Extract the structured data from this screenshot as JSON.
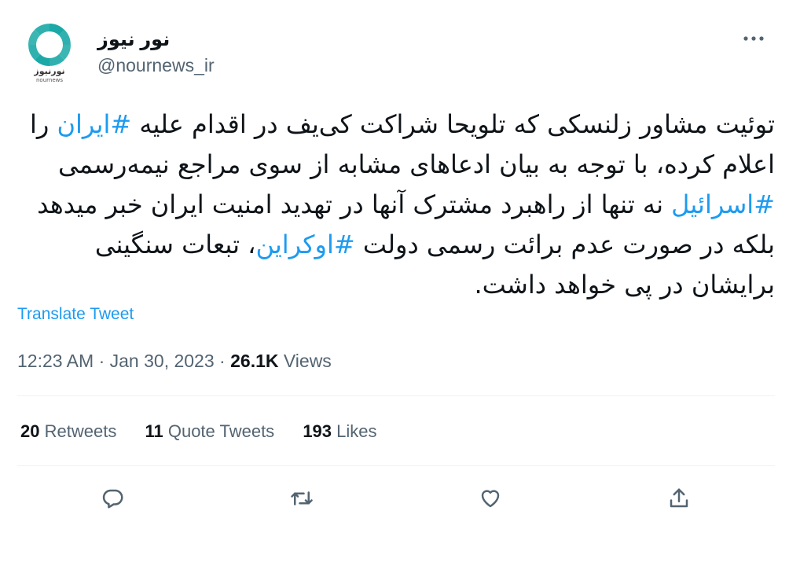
{
  "author": {
    "name": "نور نیوز",
    "handle": "@nournews_ir",
    "avatar_logo_text": "نورنیوز",
    "avatar_logo_subtext": "nournews"
  },
  "tweet": {
    "segments": [
      {
        "type": "text",
        "value": "توئیت مشاور زلنسکی که تلویحا شراکت کی‌یف در اقدام علیه "
      },
      {
        "type": "hashtag",
        "value": "#ایران"
      },
      {
        "type": "text",
        "value": " را اعلام کرده، با توجه به بیان ادعاهای مشابه از سوی مراجع نیمه‌رسمی "
      },
      {
        "type": "hashtag",
        "value": "#اسرائیل"
      },
      {
        "type": "text",
        "value": " نه تنها از راهبرد مشترک آنها در تهدید امنیت ایران خبر میدهد بلکه در صورت عدم برائت رسمی دولت "
      },
      {
        "type": "hashtag",
        "value": "#اوکراین"
      },
      {
        "type": "text",
        "value": "، تبعات سنگینی برایشان در پی خواهد داشت."
      }
    ],
    "translate_label": "Translate Tweet"
  },
  "meta": {
    "time": "12:23 AM",
    "separator": "·",
    "date": "Jan 30, 2023",
    "views_count": "26.1K",
    "views_label": "Views"
  },
  "stats": {
    "retweets_count": "20",
    "retweets_label": "Retweets",
    "quotes_count": "11",
    "quotes_label": "Quote Tweets",
    "likes_count": "193",
    "likes_label": "Likes"
  },
  "icons": {
    "more": "more-dots-icon",
    "reply": "reply-icon",
    "retweet": "retweet-icon",
    "like": "like-icon",
    "share": "share-icon"
  },
  "colors": {
    "accent": "#1d9bf0",
    "text": "#0f1419",
    "secondary": "#536471",
    "divider": "#eff3f4",
    "logo": "#1aa9a6"
  }
}
